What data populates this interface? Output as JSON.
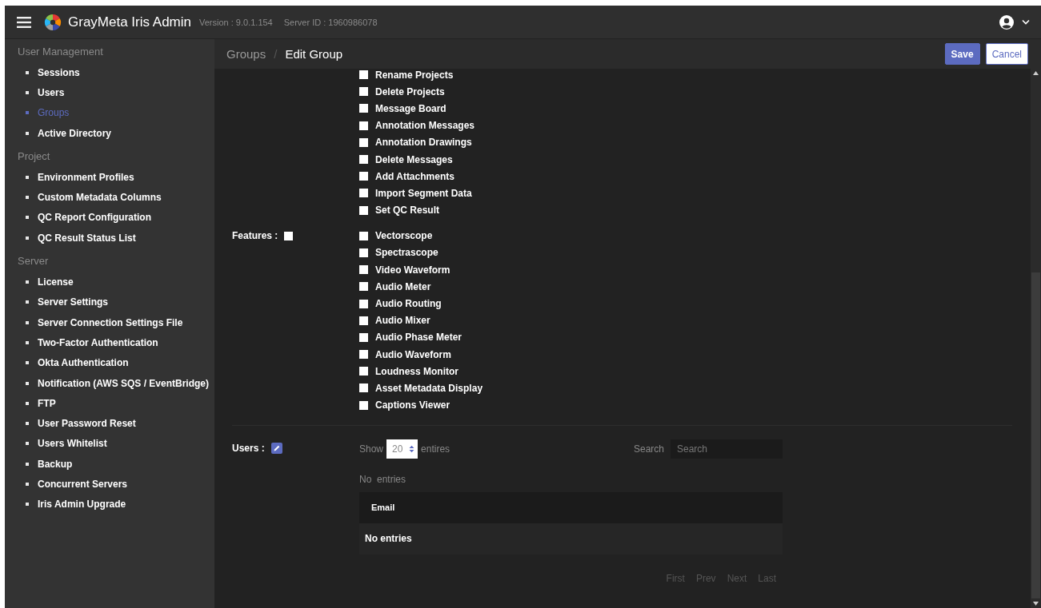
{
  "header": {
    "title": "GrayMeta Iris Admin",
    "version": "Version : 9.0.1.154",
    "server_id": "Server ID : 1960986078"
  },
  "sidebar": {
    "sections": [
      {
        "title": "User Management",
        "items": [
          {
            "label": "Sessions",
            "selected": false
          },
          {
            "label": "Users",
            "selected": false
          },
          {
            "label": "Groups",
            "selected": true
          },
          {
            "label": "Active Directory",
            "selected": false
          }
        ]
      },
      {
        "title": "Project",
        "items": [
          {
            "label": "Environment Profiles",
            "selected": false
          },
          {
            "label": "Custom Metadata Columns",
            "selected": false
          },
          {
            "label": "QC Report Configuration",
            "selected": false
          },
          {
            "label": "QC Result Status List",
            "selected": false
          }
        ]
      },
      {
        "title": "Server",
        "items": [
          {
            "label": "License",
            "selected": false
          },
          {
            "label": "Server Settings",
            "selected": false
          },
          {
            "label": "Server Connection Settings File",
            "selected": false
          },
          {
            "label": "Two-Factor Authentication",
            "selected": false
          },
          {
            "label": "Okta Authentication",
            "selected": false
          },
          {
            "label": "Notification (AWS SQS / EventBridge)",
            "selected": false
          },
          {
            "label": "FTP",
            "selected": false
          },
          {
            "label": "User Password Reset",
            "selected": false
          },
          {
            "label": "Users Whitelist",
            "selected": false
          },
          {
            "label": "Backup",
            "selected": false
          },
          {
            "label": "Concurrent Servers",
            "selected": false
          },
          {
            "label": "Iris Admin Upgrade",
            "selected": false
          }
        ]
      }
    ]
  },
  "breadcrumb": {
    "parent": "Groups",
    "separator": "/",
    "current": "Edit Group"
  },
  "buttons": {
    "save": "Save",
    "cancel": "Cancel"
  },
  "permissions": [
    {
      "label": "Rename Projects",
      "checked": false
    },
    {
      "label": "Delete Projects",
      "checked": false
    },
    {
      "label": "Message Board",
      "checked": false
    },
    {
      "label": "Annotation Messages",
      "checked": false
    },
    {
      "label": "Annotation Drawings",
      "checked": false
    },
    {
      "label": "Delete Messages",
      "checked": false
    },
    {
      "label": "Add Attachments",
      "checked": false
    },
    {
      "label": "Import Segment Data",
      "checked": false
    },
    {
      "label": "Set QC Result",
      "checked": false
    }
  ],
  "features": {
    "label": "Features :",
    "checked": false,
    "items": [
      {
        "label": "Vectorscope",
        "checked": false
      },
      {
        "label": "Spectrascope",
        "checked": false
      },
      {
        "label": "Video Waveform",
        "checked": false
      },
      {
        "label": "Audio Meter",
        "checked": false
      },
      {
        "label": "Audio Routing",
        "checked": false
      },
      {
        "label": "Audio Mixer",
        "checked": false
      },
      {
        "label": "Audio Phase Meter",
        "checked": false
      },
      {
        "label": "Audio Waveform",
        "checked": false
      },
      {
        "label": "Loudness Monitor",
        "checked": false
      },
      {
        "label": "Asset Metadata Display",
        "checked": false
      },
      {
        "label": "Captions Viewer",
        "checked": false
      }
    ]
  },
  "users": {
    "label": "Users :",
    "show_label": "Show",
    "page_size": "20",
    "entries_label": "entires",
    "search_label": "Search",
    "search_placeholder": "Search",
    "info": "No  entries",
    "columns": [
      "Email"
    ],
    "empty_message": "No entries",
    "pagination": [
      {
        "label": "First",
        "disabled": true
      },
      {
        "label": "Prev",
        "disabled": true
      },
      {
        "label": "Next",
        "disabled": true
      },
      {
        "label": "Last",
        "disabled": true
      }
    ]
  }
}
